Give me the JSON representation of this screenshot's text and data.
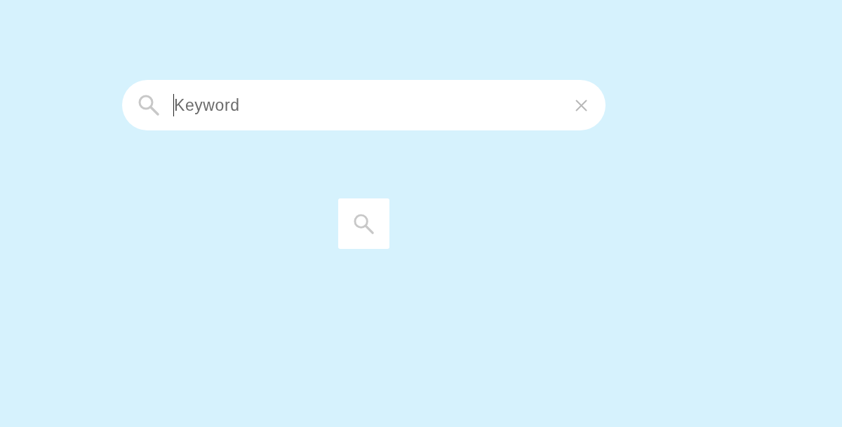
{
  "search": {
    "placeholder": "Keyword",
    "focused": true
  }
}
